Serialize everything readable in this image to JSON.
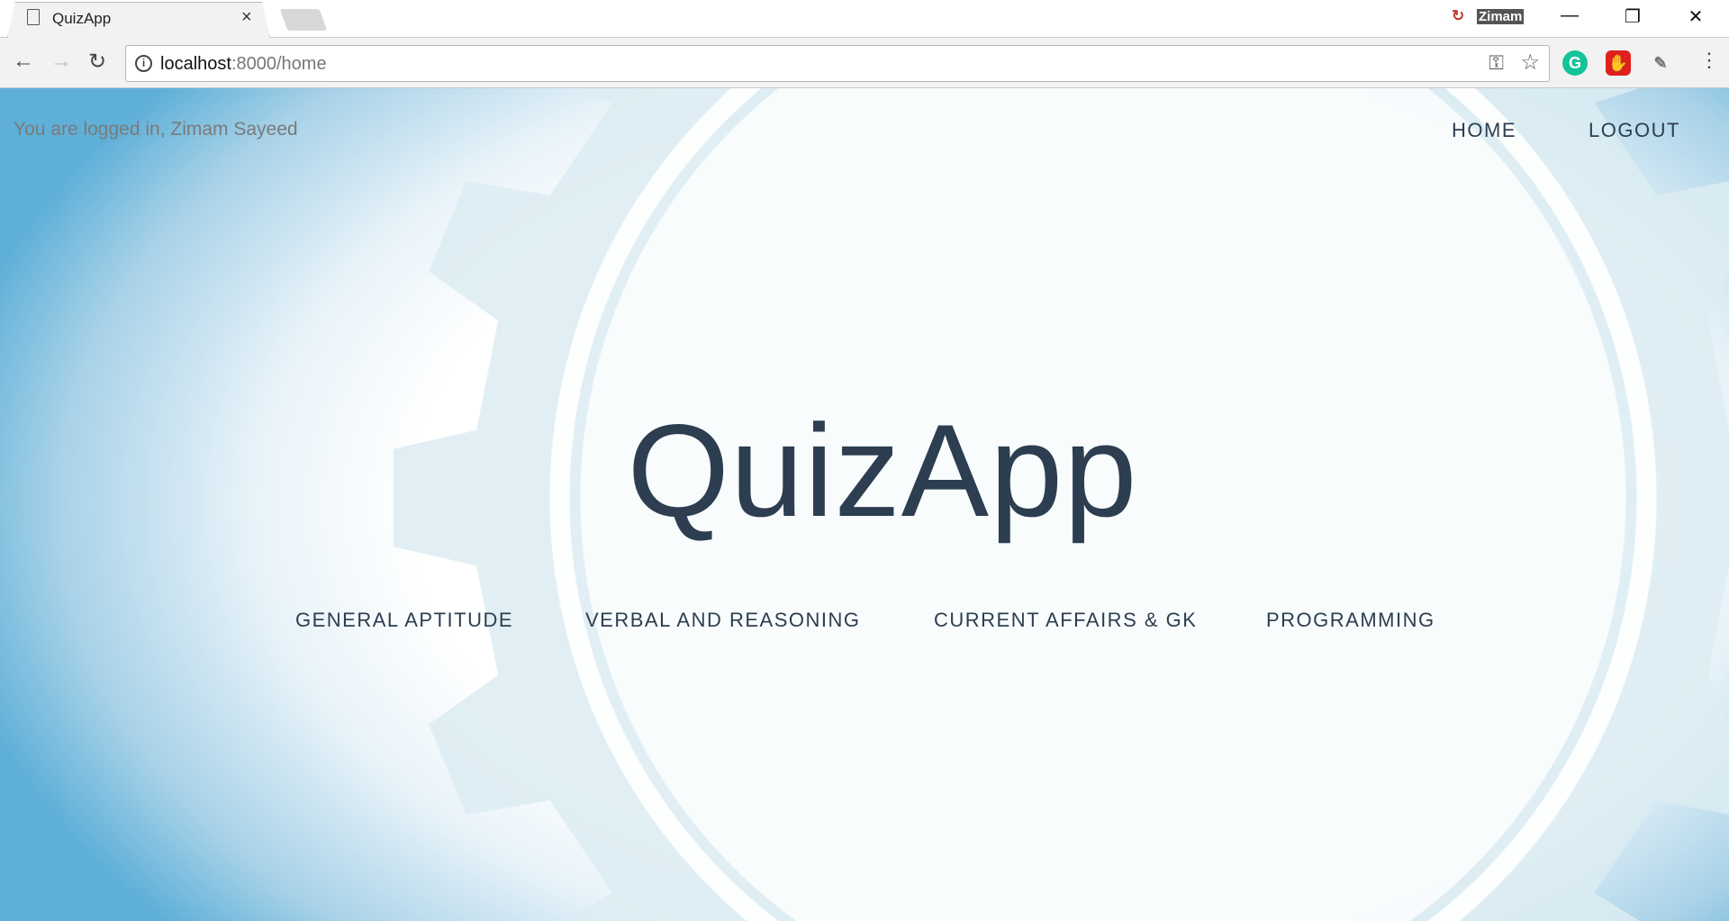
{
  "browser": {
    "tab_title": "QuizApp",
    "profile": "Zimam",
    "url_host": "localhost",
    "url_rest": ":8000/home"
  },
  "header": {
    "login_text": "You are logged in, Zimam Sayeed",
    "nav": [
      "HOME",
      "LOGOUT"
    ]
  },
  "main": {
    "title": "QuizApp",
    "categories": [
      "GENERAL APTITUDE",
      "VERBAL AND REASONING",
      "CURRENT AFFAIRS & GK",
      "PROGRAMMING"
    ]
  },
  "colors": {
    "text": "#2c3e50",
    "gear": "#dcecf2",
    "edge": "#5fb0d8"
  }
}
